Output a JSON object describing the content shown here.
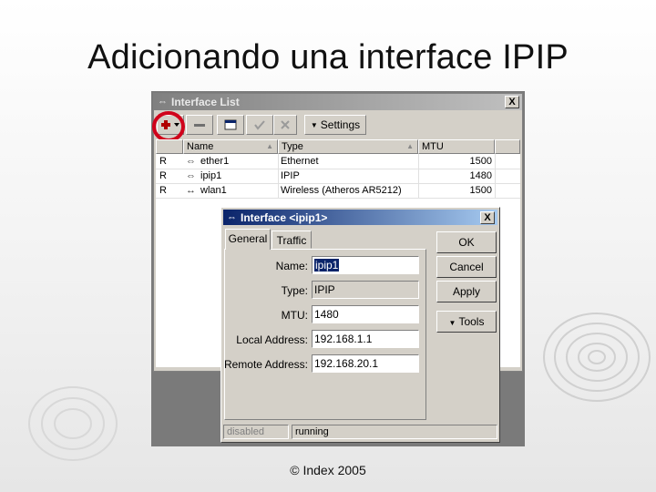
{
  "slide": {
    "title": "Adicionando una interface IPIP",
    "footer": "© Index 2005"
  },
  "interface_list": {
    "title": "Interface List",
    "title_icon": "arrows-icon",
    "toolbar": {
      "add_icon": "plus-icon",
      "remove_icon": "minus-icon",
      "comment_icon": "comment-icon",
      "enable_icon": "check-icon",
      "disable_icon": "x-icon",
      "settings_label": "Settings"
    },
    "columns": [
      "Name",
      "Type",
      "MTU"
    ],
    "rows": [
      {
        "flag": "R",
        "name": "ether1",
        "type": "Ethernet",
        "mtu": "1500"
      },
      {
        "flag": "R",
        "name": "ipip1",
        "type": "IPIP",
        "mtu": "1480"
      },
      {
        "flag": "R",
        "name": "wlan1",
        "type": "Wireless (Atheros AR5212)",
        "mtu": "1500"
      }
    ],
    "close_label": "X"
  },
  "interface_dialog": {
    "title": "Interface <ipip1>",
    "tabs": [
      "General",
      "Traffic"
    ],
    "fields": {
      "name_label": "Name:",
      "name_value": "ipip1",
      "type_label": "Type:",
      "type_value": "IPIP",
      "mtu_label": "MTU:",
      "mtu_value": "1480",
      "local_label": "Local Address:",
      "local_value": "192.168.1.1",
      "remote_label": "Remote Address:",
      "remote_value": "192.168.20.1"
    },
    "buttons": {
      "ok": "OK",
      "cancel": "Cancel",
      "apply": "Apply",
      "tools": "Tools"
    },
    "status": {
      "left": "disabled",
      "right": "running"
    },
    "close_label": "X"
  },
  "colors": {
    "title_active": "#0a246a",
    "title_inactive": "#808080",
    "highlight": "#d0021b",
    "window_face": "#d4d0c8"
  }
}
